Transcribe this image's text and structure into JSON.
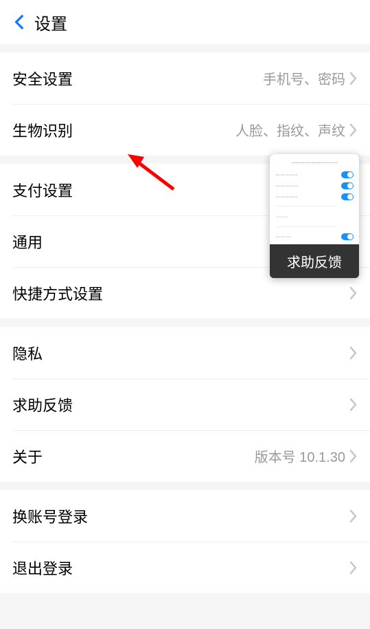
{
  "header": {
    "title": "设置"
  },
  "groups": [
    {
      "rows": [
        {
          "label": "安全设置",
          "value": "手机号、密码"
        },
        {
          "label": "生物识别",
          "value": "人脸、指纹、声纹"
        }
      ]
    },
    {
      "rows": [
        {
          "label": "支付设置",
          "value": ""
        },
        {
          "label": "通用",
          "value": ""
        },
        {
          "label": "快捷方式设置",
          "value": ""
        }
      ]
    },
    {
      "rows": [
        {
          "label": "隐私",
          "value": ""
        },
        {
          "label": "求助反馈",
          "value": ""
        },
        {
          "label": "关于",
          "value": "版本号 10.1.30"
        }
      ]
    },
    {
      "rows": [
        {
          "label": "换账号登录",
          "value": ""
        },
        {
          "label": "退出登录",
          "value": ""
        }
      ]
    }
  ],
  "popup": {
    "toggles": [
      {
        "on": true
      },
      {
        "on": true
      },
      {
        "on": true
      },
      {
        "on": true
      }
    ],
    "label": "求助反馈"
  }
}
